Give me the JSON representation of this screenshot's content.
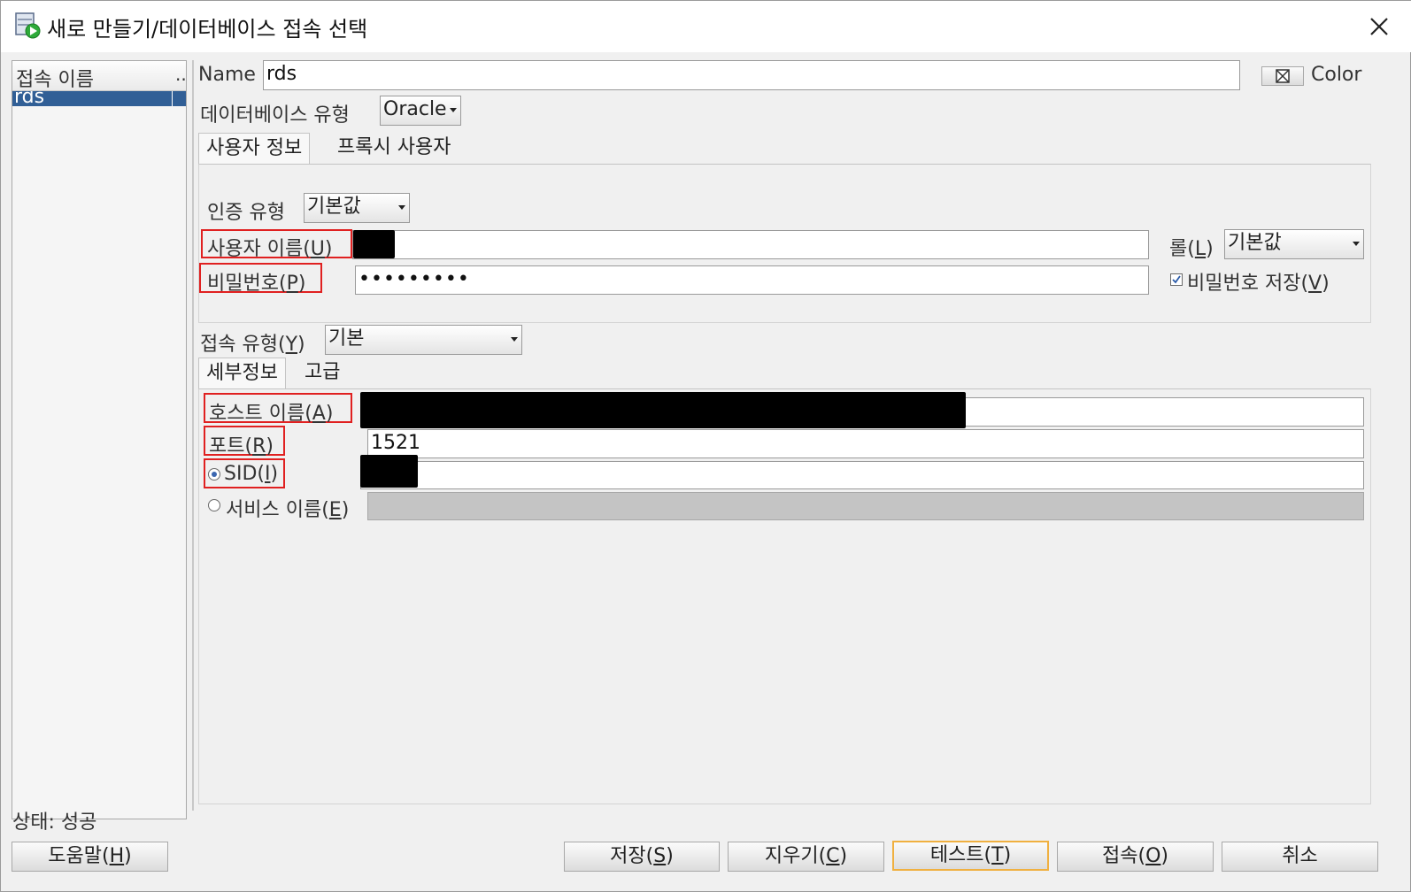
{
  "window": {
    "title": "새로 만들기/데이터베이스 접속 선택",
    "close_glyph": "✕"
  },
  "connections": {
    "header": "접속 이름",
    "header_more": "..",
    "items": [
      {
        "label": "rds",
        "selected": true
      }
    ]
  },
  "form": {
    "name_label": "Name",
    "name_value": "rds",
    "color_label": "Color",
    "db_type_label": "데이터베이스 유형",
    "db_type_value": "Oracle",
    "tabs": [
      "사용자 정보",
      "프록시 사용자"
    ],
    "auth_type_label": "인증 유형",
    "auth_type_value": "기본값",
    "username_label": "사용자 이름",
    "username_mnemonic": "U",
    "password_label": "비밀번호",
    "password_mnemonic": "P",
    "password_value": "•••••••••",
    "role_label": "롤",
    "role_mnemonic": "L",
    "role_value": "기본값",
    "save_password_label": "비밀번호 저장",
    "save_password_mnemonic": "V",
    "save_password_checked": true,
    "conn_type_label": "접속 유형",
    "conn_type_mnemonic": "Y",
    "conn_type_value": "기본",
    "detail_tabs": [
      "세부정보",
      "고급"
    ],
    "host_label": "호스트 이름",
    "host_mnemonic": "A",
    "port_label": "포트",
    "port_mnemonic": "R",
    "port_value": "1521",
    "sid_label": "SID",
    "sid_mnemonic": "I",
    "service_label": "서비스 이름",
    "service_mnemonic": "E"
  },
  "status": {
    "label": "상태",
    "value": "성공"
  },
  "buttons": {
    "help": {
      "text": "도움말",
      "mnemonic": "H"
    },
    "save": {
      "text": "저장",
      "mnemonic": "S"
    },
    "clear": {
      "text": "지우기",
      "mnemonic": "C"
    },
    "test": {
      "text": "테스트",
      "mnemonic": "T"
    },
    "connect": {
      "text": "접속",
      "mnemonic": "O"
    },
    "cancel": {
      "text": "취소"
    }
  },
  "colors": {
    "selection": "#315f96",
    "highlight_box": "#e02020",
    "default_button_border": "#f0b040"
  }
}
